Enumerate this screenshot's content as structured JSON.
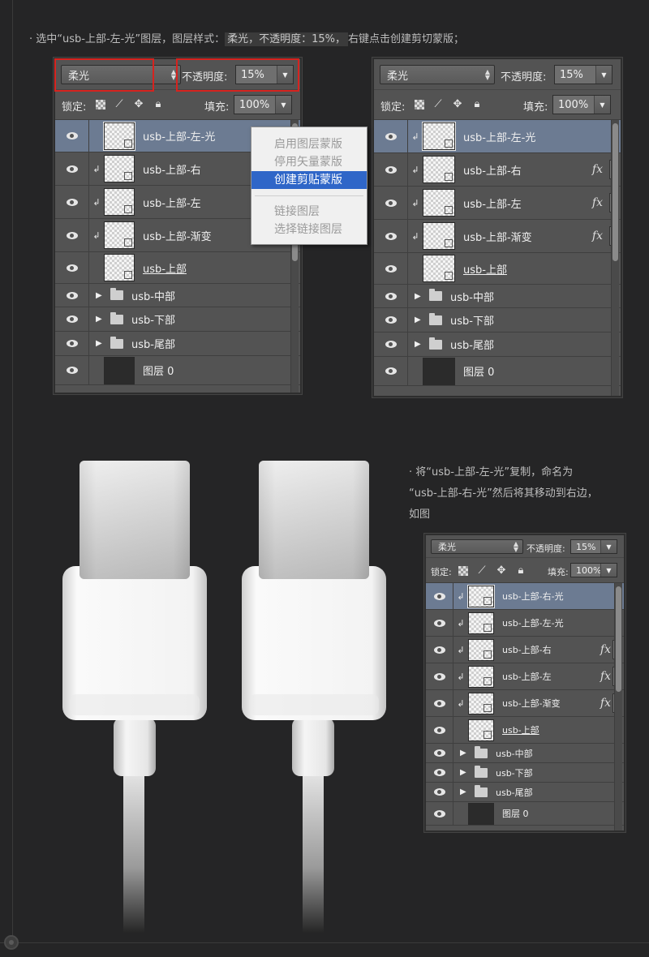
{
  "step1": {
    "prefix": "· 选中“usb-上部-左-光”图层，图层样式：",
    "highlight": "柔光，不透明度：15%，",
    "suffix": "右键点击创建剪切蒙版；"
  },
  "step2": {
    "lines": [
      "· 将“usb-上部-左-光”复制，命名为",
      "“usb-上部-右-光”然后将其移动到右边，",
      "如图"
    ]
  },
  "panel_common": {
    "blend_mode": "柔光",
    "opacity_label": "不透明度:",
    "opacity_value": "15%",
    "lock_label": "锁定:",
    "fill_label": "填充:",
    "fill_value": "100%"
  },
  "panel1": {
    "layers": [
      {
        "name": "usb-上部-左-光",
        "selected": true
      },
      {
        "name": "usb-上部-右",
        "clip": true
      },
      {
        "name": "usb-上部-左",
        "clip": true
      },
      {
        "name": "usb-上部-渐变",
        "clip": true
      },
      {
        "name": "usb-上部",
        "underline": true
      },
      {
        "name": "usb-中部",
        "group": true
      },
      {
        "name": "usb-下部",
        "group": true
      },
      {
        "name": "usb-尾部",
        "group": true
      },
      {
        "name": "图层 0",
        "dark": true
      }
    ]
  },
  "context_menu": {
    "items": [
      "启用图层蒙版",
      "停用矢量蒙版",
      "创建剪贴蒙版",
      "链接图层",
      "选择链接图层"
    ],
    "active_index": 2
  },
  "panel2": {
    "layers": [
      {
        "name": "usb-上部-左-光",
        "selected": true,
        "clip": true
      },
      {
        "name": "usb-上部-右",
        "clip": true,
        "fx": true
      },
      {
        "name": "usb-上部-左",
        "clip": true,
        "fx": true
      },
      {
        "name": "usb-上部-渐变",
        "clip": true,
        "fx": true
      },
      {
        "name": "usb-上部",
        "underline": true
      },
      {
        "name": "usb-中部",
        "group": true
      },
      {
        "name": "usb-下部",
        "group": true
      },
      {
        "name": "usb-尾部",
        "group": true
      },
      {
        "name": "图层 0",
        "dark": true
      }
    ]
  },
  "panel3": {
    "layers": [
      {
        "name": "usb-上部-右-光",
        "selected": true,
        "clip": true
      },
      {
        "name": "usb-上部-左-光",
        "clip": true
      },
      {
        "name": "usb-上部-右",
        "clip": true,
        "fx": true
      },
      {
        "name": "usb-上部-左",
        "clip": true,
        "fx": true
      },
      {
        "name": "usb-上部-渐变",
        "clip": true,
        "fx": true
      },
      {
        "name": "usb-上部",
        "underline": true
      },
      {
        "name": "usb-中部",
        "group": true
      },
      {
        "name": "usb-下部",
        "group": true
      },
      {
        "name": "usb-尾部",
        "group": true
      },
      {
        "name": "图层 0",
        "dark": true
      }
    ]
  },
  "fx_symbol": "fx",
  "icons": {
    "eye": "eye-icon",
    "clip": "clip-arrow-icon",
    "folder": "folder-icon",
    "expand": "triangle-right-icon",
    "lock": "lock-icon",
    "move": "move-icon",
    "brush": "brush-icon",
    "transparency": "checker-icon"
  },
  "colors": {
    "background": "#252526",
    "panel": "#535353",
    "selected_row": "#6c7b92",
    "highlight_box": "#d6231f",
    "menu_active": "#2f66c8"
  }
}
